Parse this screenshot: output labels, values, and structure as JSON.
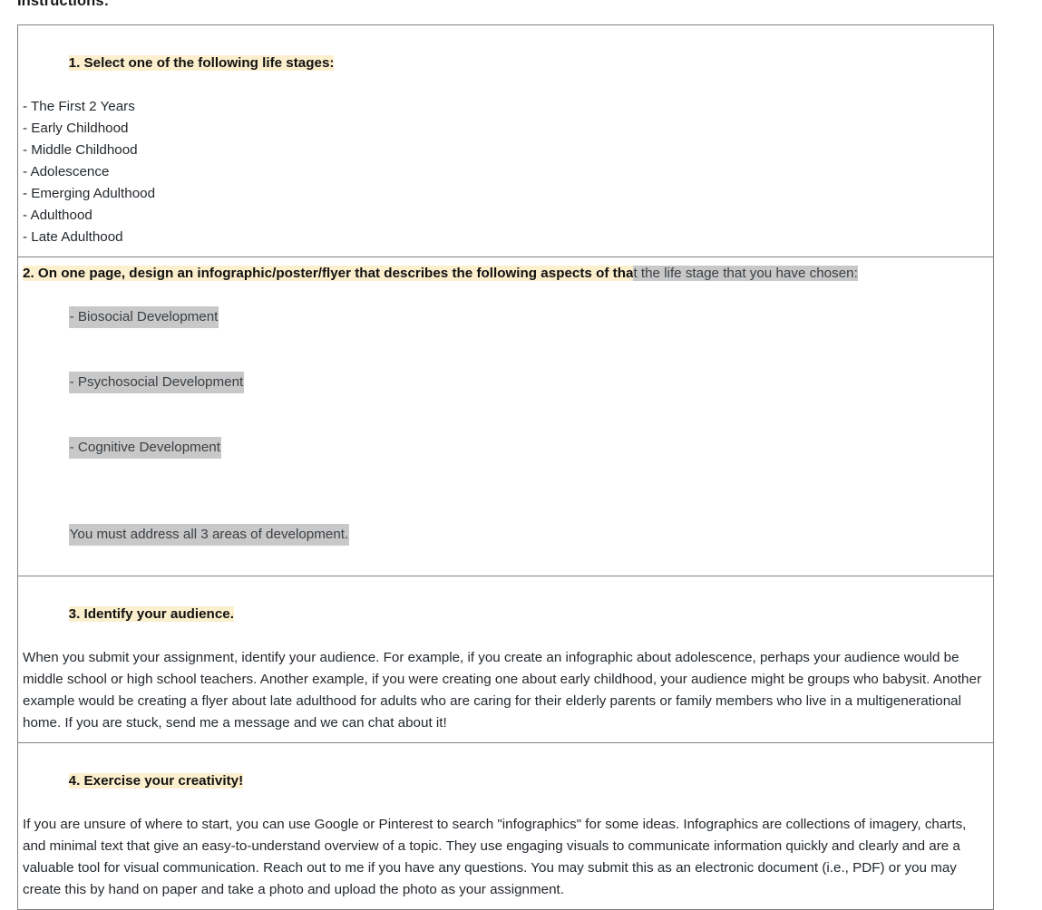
{
  "document": {
    "heading": "Instructions:"
  },
  "sections": [
    {
      "id": "section-1",
      "heading": "1. Select one of the following life stages:",
      "highlight_color": "#fbefcd",
      "items": [
        "- The First 2 Years",
        "- Early Childhood",
        "- Middle Childhood",
        "- Adolescence",
        "- Emerging Adulthood",
        "- Adulthood",
        "- Late Adulthood"
      ]
    },
    {
      "id": "section-2",
      "heading_unselected": "2. On one page, design an infographic/poster/flyer that describes the following aspects of tha",
      "heading_selected": "t the life stage that you have chosen:",
      "highlight_color": "#fbefcd",
      "selection_color": "#c8c8c8",
      "items": [
        "- Biosocial Development",
        "- Psychosocial Development",
        "- Cognitive Development"
      ],
      "note": "You must address all 3 areas of development."
    },
    {
      "id": "section-3",
      "heading": "3. Identify your audience.",
      "highlight_color": "#fbefcd",
      "body": "When you submit your assignment, identify your audience. For example, if you create an infographic about adolescence, perhaps your audience would be middle school or high school teachers. Another example, if you were creating one about early childhood, your audience might be groups who babysit. Another example would be creating a flyer about late adulthood for adults who are caring for their elderly parents or family members who live in a multigenerational home. If you are stuck, send me a message and we can chat about it!"
    },
    {
      "id": "section-4",
      "heading": "4. Exercise your creativity!",
      "highlight_color": "#fbefcd",
      "body": "If you are unsure of where to start, you can use Google or Pinterest to search \"infographics\" for some ideas. Infographics are collections of imagery, charts, and minimal text that give an easy-to-understand overview of a topic. They use engaging visuals to communicate information quickly and clearly and are a valuable tool for visual communication. Reach out to me if you have any questions. You may submit this as an electronic document (i.e., PDF) or you may create this by hand on paper and take a photo and upload the photo as your assignment."
    }
  ]
}
